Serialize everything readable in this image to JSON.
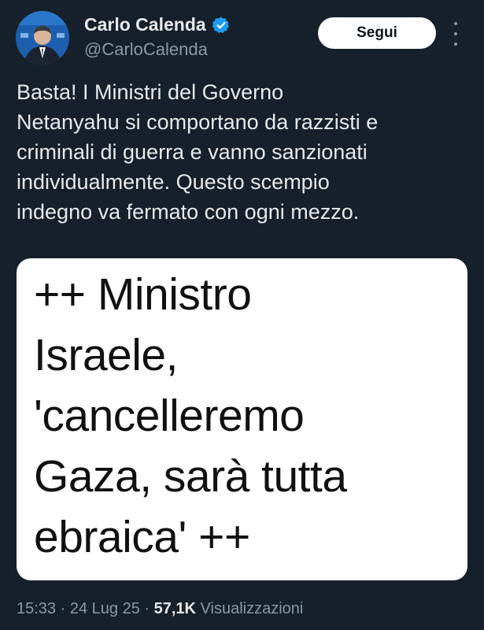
{
  "author": {
    "name": "Carlo Calenda",
    "handle": "@CarloCalenda",
    "verified_icon": "verified-badge-icon"
  },
  "follow_label": "Segui",
  "tweet": {
    "text": "Basta! I Ministri del Governo\nNetanyahu si comportano da razzisti e\ncriminali di guerra e vanno sanzionati\nindividualmente. Questo scempio\nindegno va fermato con ogni mezzo.",
    "image_text": "++ Ministro\nIsraele,\n'cancelleremo\nGaza, sarà tutta\nebraica' ++"
  },
  "meta": {
    "time": "15:33",
    "date": "24 Lug 25",
    "separator": " · ",
    "views_count": "57,1K",
    "views_label": "Visualizzazioni"
  },
  "colors": {
    "background": "#15202b",
    "verified": "#1d9bf0",
    "secondary_text": "#8b98a5"
  }
}
